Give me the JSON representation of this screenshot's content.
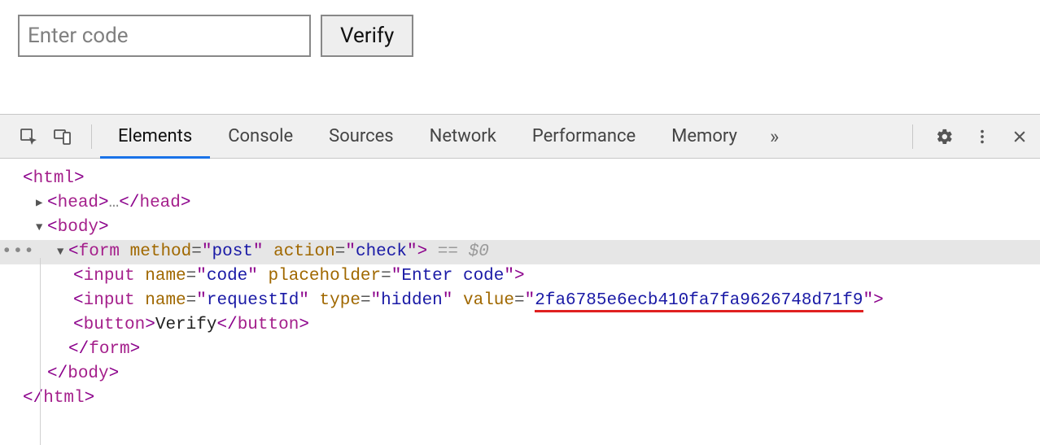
{
  "page": {
    "input_placeholder": "Enter code",
    "verify_label": "Verify"
  },
  "devtools": {
    "tabs": [
      "Elements",
      "Console",
      "Sources",
      "Network",
      "Performance",
      "Memory"
    ],
    "active_tab": "Elements",
    "overflow": "»",
    "head_dots": "…"
  },
  "tree": {
    "html_open": "<html>",
    "head_open": "<head>",
    "head_close": "</head>",
    "body_open": "<body>",
    "form": {
      "tag": "form",
      "method_name": "method",
      "method_value": "post",
      "action_name": "action",
      "action_value": "check",
      "hint": " == $0"
    },
    "input_code": {
      "tag": "input",
      "name_name": "name",
      "name_value": "code",
      "ph_name": "placeholder",
      "ph_value": "Enter code"
    },
    "input_hidden": {
      "tag": "input",
      "name_name": "name",
      "name_value": "requestId",
      "type_name": "type",
      "type_value": "hidden",
      "value_name": "value",
      "value_value": "2fa6785e6ecb410fa7fa9626748d71f9"
    },
    "button": {
      "tag": "button",
      "text": "Verify"
    },
    "form_close": "</form>",
    "body_close": "</body>",
    "html_close": "</html>"
  }
}
